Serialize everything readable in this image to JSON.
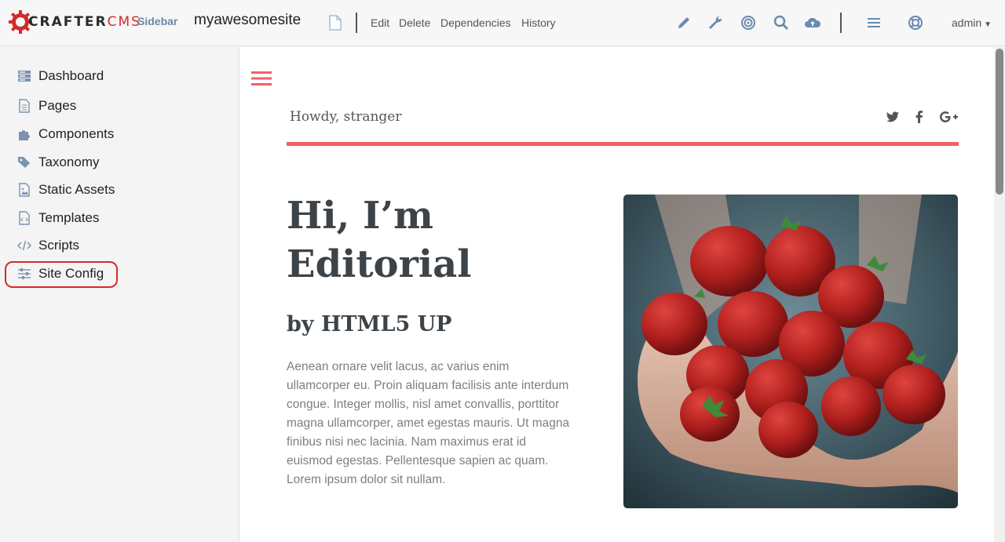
{
  "header": {
    "logo_part1": "CRAFTER",
    "logo_part2": "CMS",
    "sidebar_toggle": "Sidebar",
    "site_name": "myawesomesite",
    "menu": [
      "Edit",
      "Delete",
      "Dependencies",
      "History"
    ],
    "toolbar_icons": [
      "pencil-icon",
      "wrench-icon",
      "target-icon",
      "search-icon",
      "cloud-upload-icon",
      "hamburger-icon",
      "lifebuoy-icon"
    ],
    "user": "admin"
  },
  "sidebar": {
    "items": [
      {
        "label": "Dashboard",
        "icon": "dashboard-icon"
      },
      {
        "label": "Pages",
        "icon": "page-icon"
      },
      {
        "label": "Components",
        "icon": "puzzle-icon"
      },
      {
        "label": "Taxonomy",
        "icon": "tags-icon"
      },
      {
        "label": "Static Assets",
        "icon": "image-file-icon"
      },
      {
        "label": "Templates",
        "icon": "code-file-icon"
      },
      {
        "label": "Scripts",
        "icon": "code-icon"
      },
      {
        "label": "Site Config",
        "icon": "sliders-icon"
      }
    ]
  },
  "preview": {
    "greeting": "Howdy, stranger",
    "social": [
      "twitter-icon",
      "facebook-icon",
      "google-plus-icon"
    ],
    "title_line1": "Hi, I’m",
    "title_line2": "Editorial",
    "subtitle": "by HTML5 UP",
    "body": "Aenean ornare velit lacus, ac varius enim ullamcorper eu. Proin aliquam facilisis ante interdum congue. Integer mollis, nisl amet convallis, porttitor magna ullamcorper, amet egestas mauris. Ut magna finibus nisi nec lacinia. Nam maximus erat id euismod egestas. Pellentesque sapien ac quam. Lorem ipsum dolor sit nullam.",
    "image": "strawberries-in-hands-photo"
  },
  "colors": {
    "accent": "#f0606a",
    "brand_red": "#d42a2a",
    "nav_icon": "#7b93ad",
    "toolbar_icon": "#6a8bb0"
  }
}
